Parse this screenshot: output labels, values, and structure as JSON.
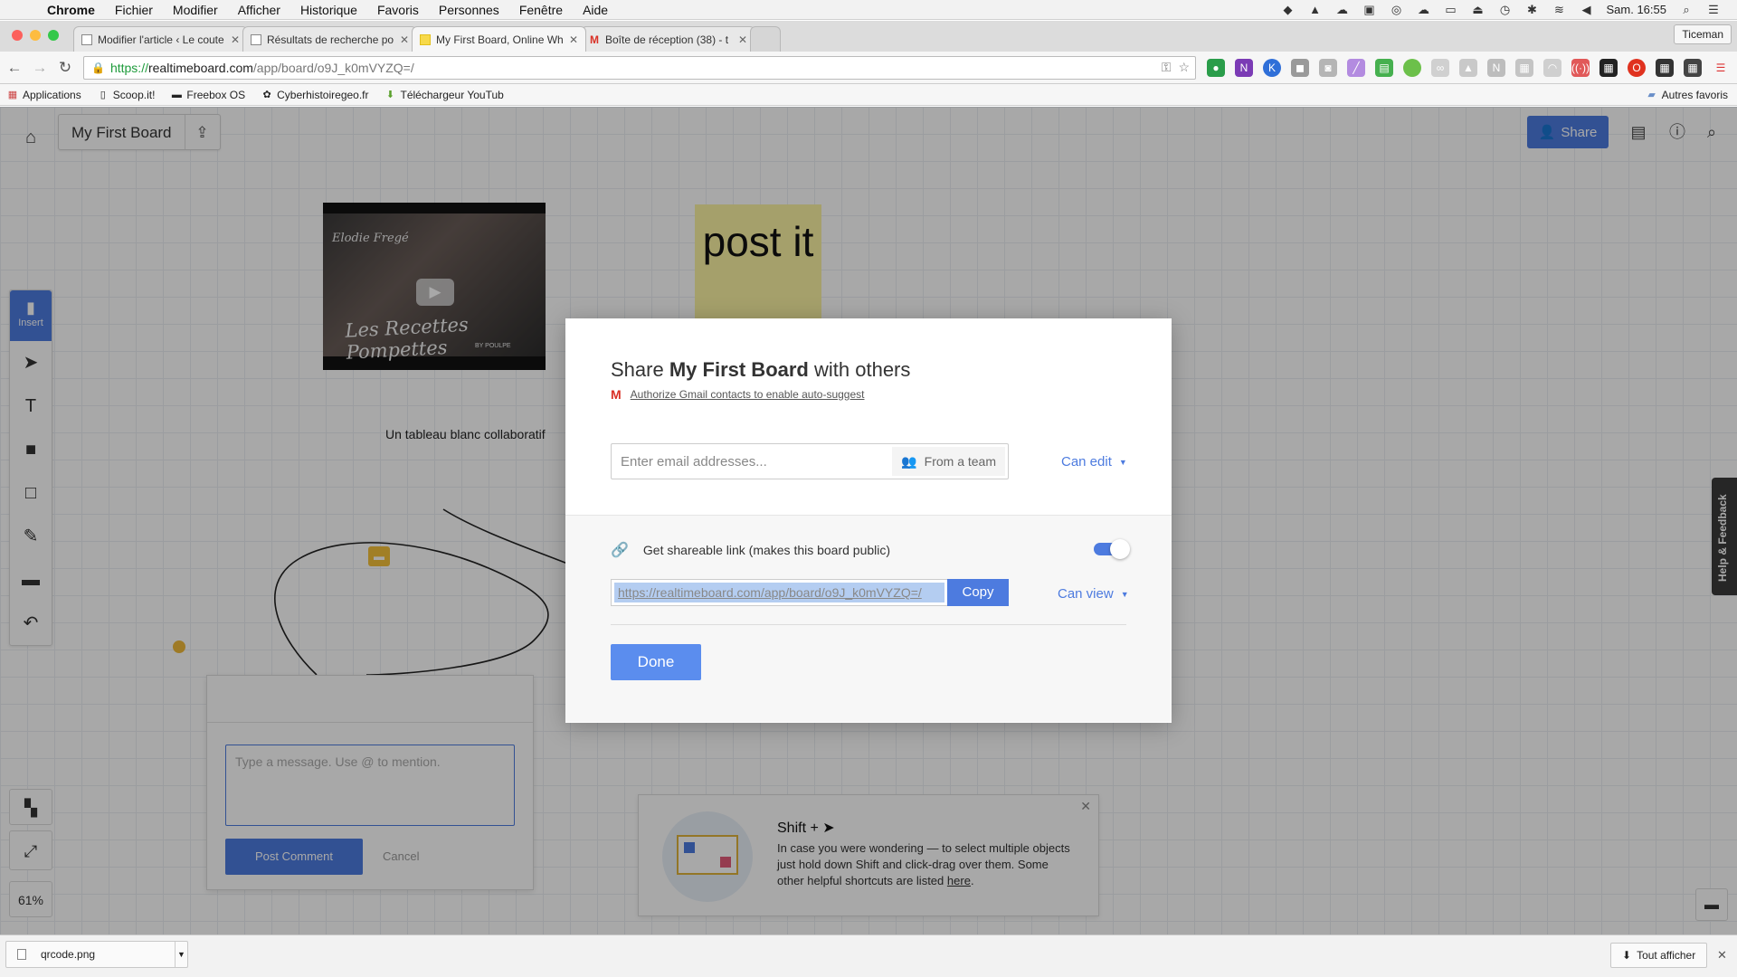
{
  "menubar": {
    "items": [
      "Chrome",
      "Fichier",
      "Modifier",
      "Afficher",
      "Historique",
      "Favoris",
      "Personnes",
      "Fenêtre",
      "Aide"
    ],
    "clock": "Sam. 16:55"
  },
  "tabs": [
    {
      "title": "Modifier l'article ‹ Le coute",
      "active": false
    },
    {
      "title": "Résultats de recherche po",
      "active": false
    },
    {
      "title": "My First Board, Online Wh",
      "active": true
    },
    {
      "title": "Boîte de réception (38) - t",
      "active": false
    }
  ],
  "profile": "Ticeman",
  "address": {
    "scheme": "https://",
    "host": "realtimeboard.com",
    "path": "/app/board/o9J_k0mVYZQ=/"
  },
  "bookmarks": {
    "items": [
      "Applications",
      "Scoop.it!",
      "Freebox OS",
      "Cyberhistoiregeo.fr",
      "Téléchargeur YouTub"
    ],
    "other": "Autres favoris"
  },
  "board": {
    "title": "My First Board",
    "share_label": "Share",
    "insert_label": "Insert",
    "zoom": "61%",
    "postit_text": "post it",
    "caption": "Un tableau blanc collaboratif",
    "video": {
      "title": "Elodie Fregé",
      "script_title": "Les Recettes Pompettes",
      "by": "BY POULPE"
    },
    "help_tab": "Help & Feedback"
  },
  "comment": {
    "placeholder": "Type a message. Use @ to mention.",
    "post_label": "Post Comment",
    "cancel_label": "Cancel"
  },
  "tip": {
    "title": "Shift +",
    "body": "In case you were wondering — to select multiple objects just hold down Shift and click-drag over them. Some other helpful shortcuts are listed",
    "link": "here",
    "period": "."
  },
  "share_modal": {
    "title_prefix": "Share",
    "board_name": "My First Board",
    "title_suffix": "with others",
    "gmail_auth": "Authorize Gmail contacts to enable auto-suggest",
    "email_placeholder": "Enter email addresses...",
    "from_team": "From a team",
    "invite_permission": "Can edit",
    "link_label": "Get shareable link (makes this board public)",
    "link_enabled": true,
    "link_url": "https://realtimeboard.com/app/board/o9J_k0mVYZQ=/",
    "copy_label": "Copy",
    "link_permission": "Can view",
    "done_label": "Done"
  },
  "downloads": {
    "file": "qrcode.png",
    "show_all": "Tout afficher"
  },
  "colors": {
    "accent": "#4d7bdf",
    "postit": "#fbf3a3",
    "pin": "#f4c13a"
  }
}
